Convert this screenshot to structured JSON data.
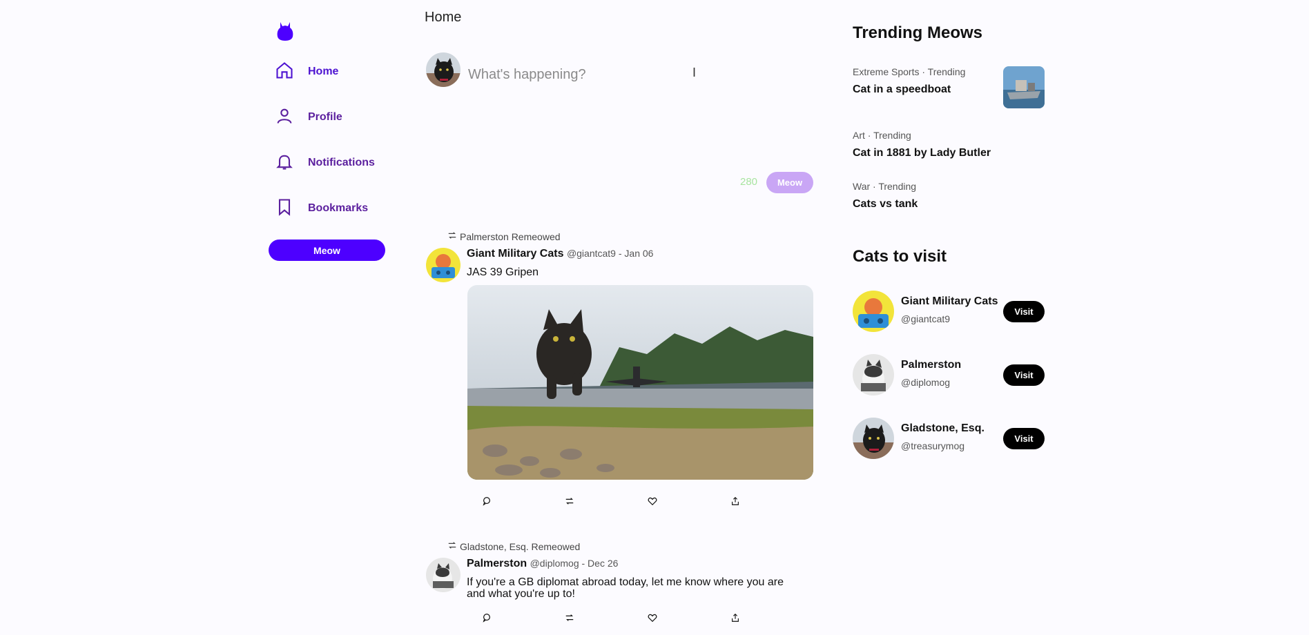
{
  "nav": {
    "items": [
      {
        "label": "Home"
      },
      {
        "label": "Profile"
      },
      {
        "label": "Notifications"
      },
      {
        "label": "Bookmarks"
      }
    ],
    "meow_button": "Meow"
  },
  "header": {
    "title": "Home"
  },
  "compose": {
    "placeholder": "What's happening?",
    "char_count": "280",
    "button": "Meow"
  },
  "posts": [
    {
      "remeow_by": "Palmerston Remeowed",
      "name": "Giant Military Cats",
      "meta": "@giantcat9 - Jan 06",
      "text": "JAS 39 Gripen"
    },
    {
      "remeow_by": "Gladstone, Esq. Remeowed",
      "name": "Palmerston",
      "meta": "@diplomog - Dec 26",
      "text": "If you're a GB diplomat abroad today, let me know where you are and what you're up to!"
    }
  ],
  "trending": {
    "title": "Trending Meows",
    "items": [
      {
        "category": "Extreme Sports · Trending",
        "title": "Cat in a speedboat"
      },
      {
        "category": "Art · Trending",
        "title": "Cat in 1881 by Lady Butler"
      },
      {
        "category": "War · Trending",
        "title": "Cats vs tank"
      }
    ]
  },
  "visit": {
    "title": "Cats to visit",
    "button": "Visit",
    "items": [
      {
        "name": "Giant Military Cats",
        "handle": "@giantcat9"
      },
      {
        "name": "Palmerston",
        "handle": "@diplomog"
      },
      {
        "name": "Gladstone, Esq.",
        "handle": "@treasurymog"
      }
    ]
  },
  "colors": {
    "brand": "#4d00ff",
    "nav_text": "#5b1f9e",
    "compose_button": "#c9a6f5",
    "char_count": "#a8e4a0"
  }
}
